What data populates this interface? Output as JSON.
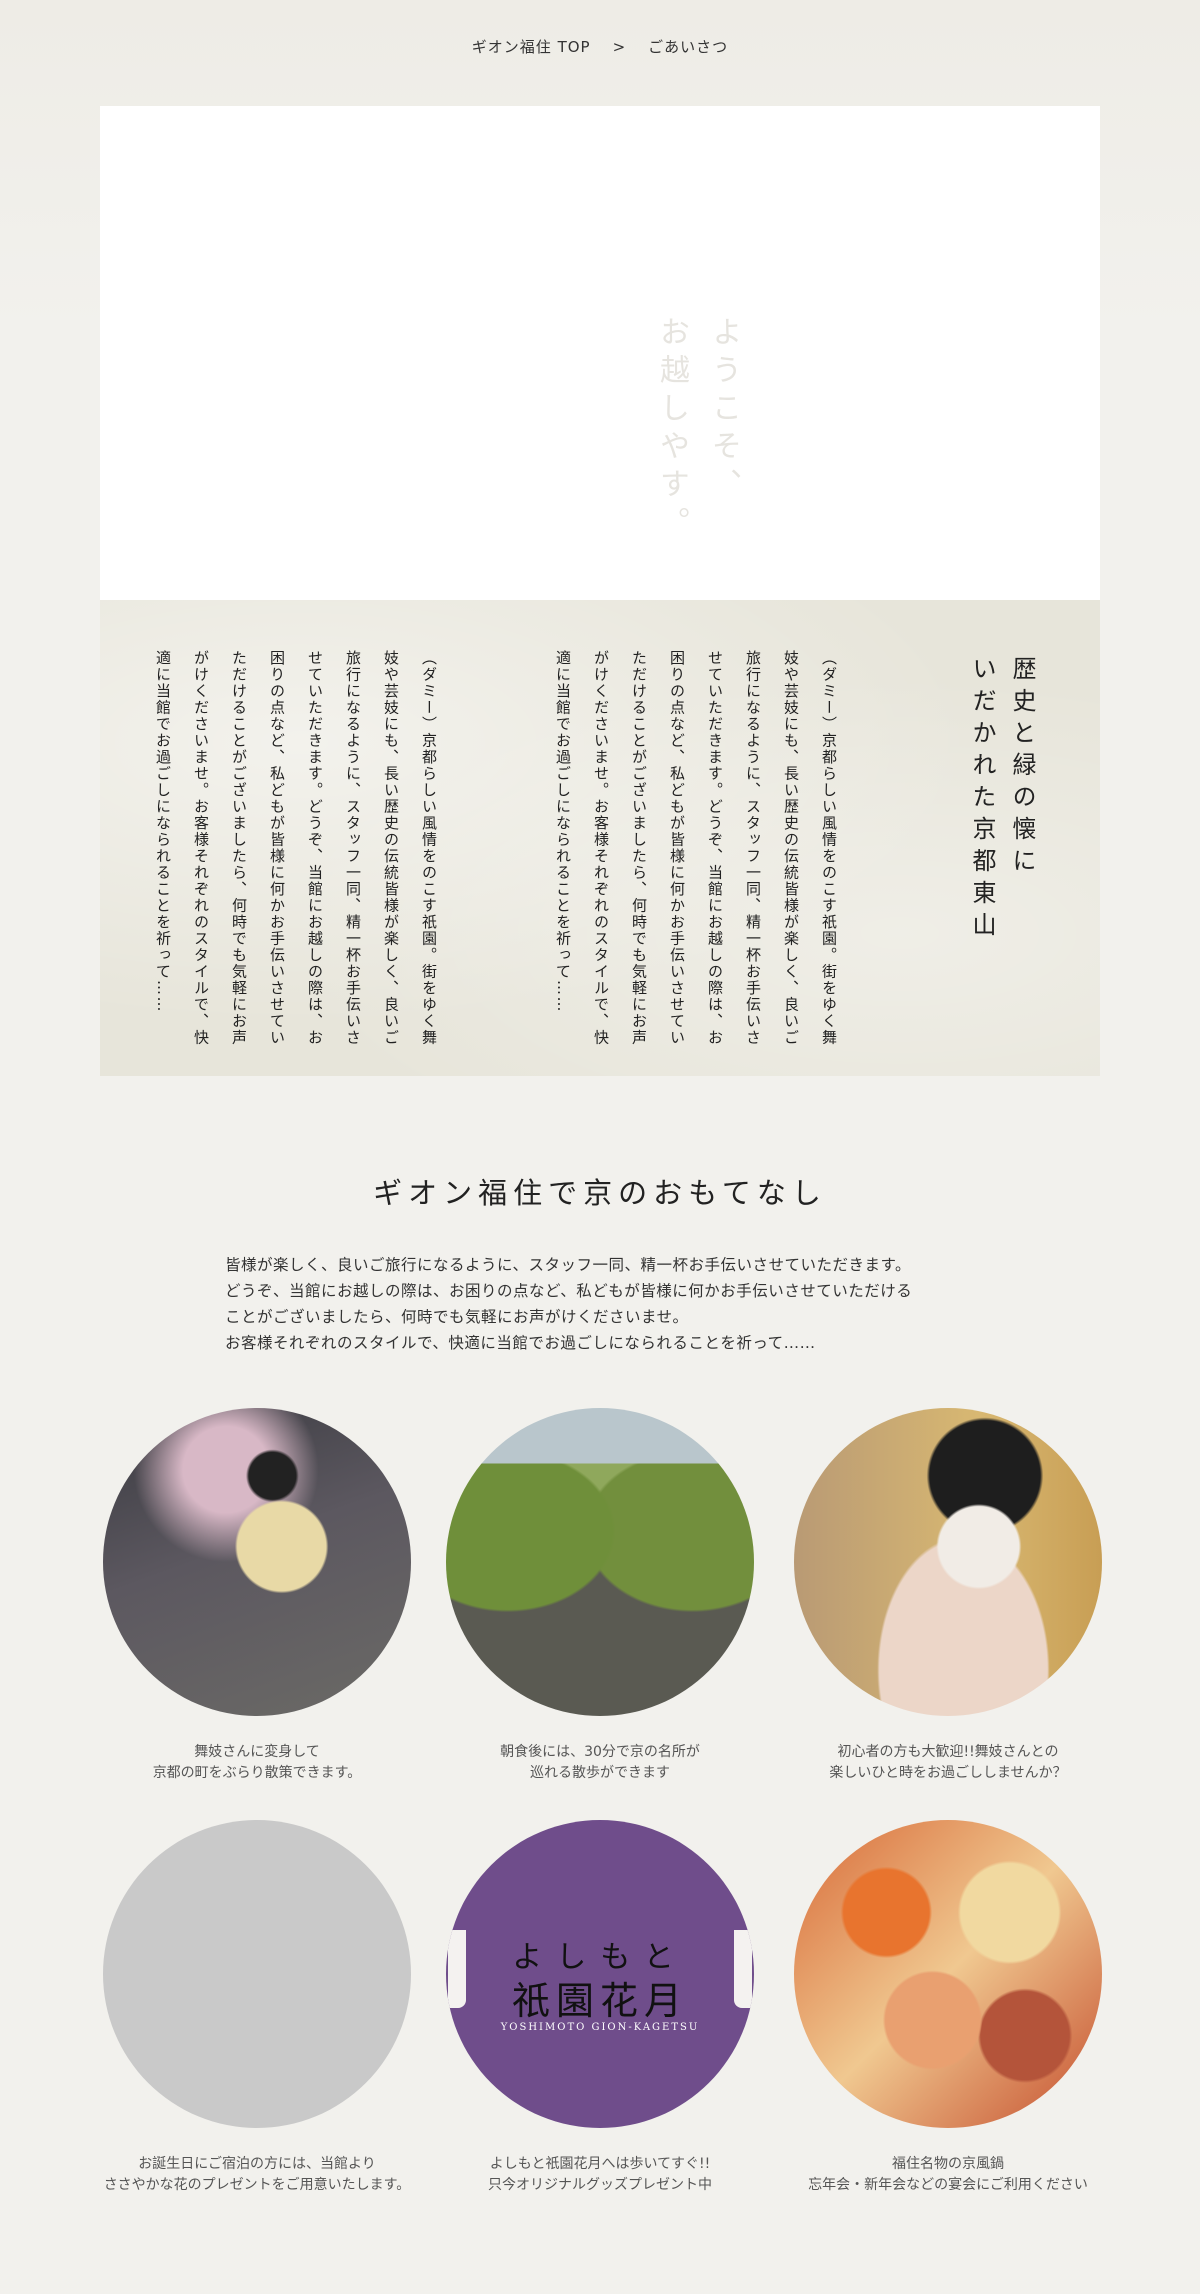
{
  "breadcrumb": {
    "home": "ギオン福住 TOP",
    "separator": ">",
    "current": "ごあいさつ"
  },
  "hero": {
    "welcome": "ようこそ、\nお越しやす。"
  },
  "vertical_panel": {
    "heading": "歴史と緑の懐に\nいだかれた京都東山",
    "paragraph_1": "（ダミー）京都らしい風情をのこす祇園。街をゆく舞妓や芸妓にも、長い歴史の伝統皆様が楽しく、良いご旅行になるように、スタッフ一同、精一杯お手伝いさせていただきます。どうぞ、当館にお越しの際は、お困りの点など、私どもが皆様に何かお手伝いさせていただけることがございましたら、何時でも気軽にお声がけくださいませ。お客様それぞれのスタイルで、快適に当館でお過ごしになられることを祈って……",
    "paragraph_2": "（ダミー）京都らしい風情をのこす祇園。街をゆく舞妓や芸妓にも、長い歴史の伝統皆様が楽しく、良いご旅行になるように、スタッフ一同、精一杯お手伝いさせていただきます。どうぞ、当館にお越しの際は、お困りの点など、私どもが皆様に何かお手伝いさせていただけることがございましたら、何時でも気軽にお声がけくださいませ。お客様それぞれのスタイルで、快適に当館でお過ごしになられることを祈って……"
  },
  "section": {
    "title": "ギオン福住で京のおもてなし",
    "intro": [
      "皆様が楽しく、良いご旅行になるように、スタッフ一同、精一杯お手伝いさせていただきます。",
      "どうぞ、当館にお越しの際は、お困りの点など、私どもが皆様に何かお手伝いさせていただける",
      "ことがございましたら、何時でも気軽にお声がけくださいませ。",
      "お客様それぞれのスタイルで、快適に当館でお過ごしになられることを祈って……"
    ]
  },
  "cards": [
    {
      "image": "maiko-photo",
      "lines": [
        "舞妓さんに変身して",
        "京都の町をぶらり散策できます。"
      ]
    },
    {
      "image": "canal-photo",
      "lines": [
        "朝食後には、30分で京の名所が",
        "巡れる散歩ができます"
      ]
    },
    {
      "image": "maiko-portrait-photo",
      "lines": [
        "初心者の方も大歓迎!!舞妓さんとの",
        "楽しいひと時をお過ごししませんか？"
      ]
    },
    {
      "image": "placeholder",
      "lines": [
        "お誕生日にご宿泊の方には、当館より",
        "ささやかな花のプレゼントをご用意いたします。"
      ]
    },
    {
      "image": "kagetsu-logo",
      "lines": [
        "よしもと祇園花月へは歩いてすぐ!!",
        "只今オリジナルグッズプレゼント中"
      ]
    },
    {
      "image": "hotpot-photo",
      "lines": [
        "福住名物の京風鍋",
        "忘年会・新年会などの宴会にご利用ください"
      ]
    }
  ],
  "kagetsu_logo": {
    "top": "よしもと",
    "main": "祇園花月",
    "roman": "YOSHIMOTO GION-KAGETSU"
  },
  "colors": {
    "background": "#f2f1ed",
    "panel": "#e7e5da",
    "kagetsu_purple": "#6f4d8b",
    "placeholder_gray": "#c9c9c9"
  }
}
